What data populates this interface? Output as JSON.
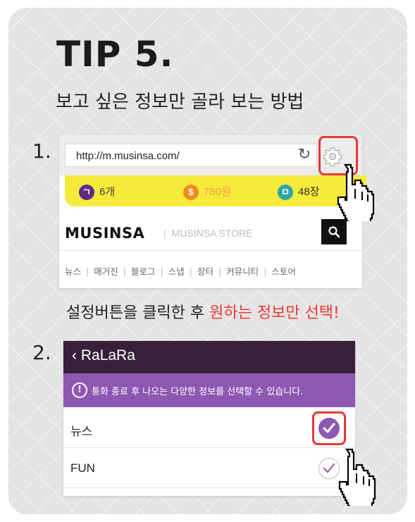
{
  "tip": {
    "title": "TIP 5.",
    "subtitle": "보고 싶은 정보만 골라 보는 방법"
  },
  "step1": {
    "number": "1.",
    "browser": {
      "url": "http://m.musinsa.com/",
      "refresh_icon": "refresh-icon",
      "settings_icon": "gear-icon"
    },
    "points": [
      {
        "badge": "ㄱ",
        "value": "6개",
        "color": "#5b2c83"
      },
      {
        "badge": "$",
        "value": "780원",
        "color": "#f08c1e"
      },
      {
        "badge": "ㅁ",
        "value": "48장",
        "color": "#2ea7a7"
      }
    ],
    "brand": "MUSINSA",
    "brand_sub": "MUSINSA STORE",
    "nav": [
      "뉴스",
      "매거진",
      "블로그",
      "스냅",
      "장터",
      "커뮤니티",
      "스토어"
    ],
    "caption_plain": "설정버튼을 클릭한 후 ",
    "caption_highlight": "원하는 정보만 선택!"
  },
  "step2": {
    "number": "2.",
    "back_label": "RaLaRa",
    "notice_icon": "!",
    "notice": "통화 종료 후 나오는 다양한 정보를 선택할 수 있습니다.",
    "rows": [
      {
        "label": "뉴스",
        "checked": true
      },
      {
        "label": "FUN",
        "checked": false
      }
    ]
  },
  "colors": {
    "highlight_red": "#e53935",
    "purple_dark": "#38203a",
    "purple": "#8e57b1",
    "yellow": "#f6ea3a"
  }
}
